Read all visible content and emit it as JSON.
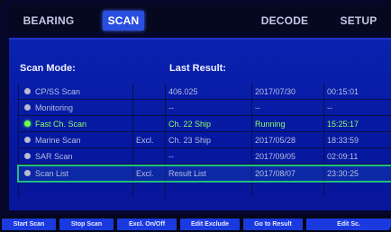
{
  "tabs": [
    {
      "label": "BEARING"
    },
    {
      "label": "SCAN"
    },
    {
      "label": "DECODE"
    },
    {
      "label": "SETUP"
    }
  ],
  "panel": {
    "scan_mode_label": "Scan Mode:",
    "last_result_label": "Last Result:"
  },
  "rows": [
    {
      "mode": "CP/SS Scan",
      "excl": "",
      "result": "406.025",
      "date": "2017/07/30",
      "time": "00:15:01",
      "state": "normal"
    },
    {
      "mode": "Monitoring",
      "excl": "",
      "result": "--",
      "date": "--",
      "time": "--",
      "state": "normal"
    },
    {
      "mode": "Fast Ch. Scan",
      "excl": "",
      "result": "Ch. 22 Ship",
      "date": "Running",
      "time": "15:25:17",
      "state": "active"
    },
    {
      "mode": "Marine Scan",
      "excl": "Excl.",
      "result": "Ch. 23 Ship",
      "date": "2017/05/28",
      "time": "18:33:59",
      "state": "normal"
    },
    {
      "mode": "SAR Scan",
      "excl": "",
      "result": "--",
      "date": "2017/09/05",
      "time": "02:09:11",
      "state": "normal"
    },
    {
      "mode": "Scan List",
      "excl": "Excl.",
      "result": "Result List",
      "date": "2017/08/07",
      "time": "23:30:25",
      "state": "selected"
    }
  ],
  "softkeys": [
    {
      "label": "Start Scan"
    },
    {
      "label": "Stop Scan"
    },
    {
      "label": "Excl. On/Off"
    },
    {
      "label": "Edit Exclude"
    },
    {
      "label": "Go to Result"
    },
    {
      "label": "Edit Sc."
    }
  ],
  "colors": {
    "panel": "#0618a0",
    "active_tab": "#2a4fe0",
    "running_green": "#6cff48",
    "selection_outline": "#22c07a"
  }
}
